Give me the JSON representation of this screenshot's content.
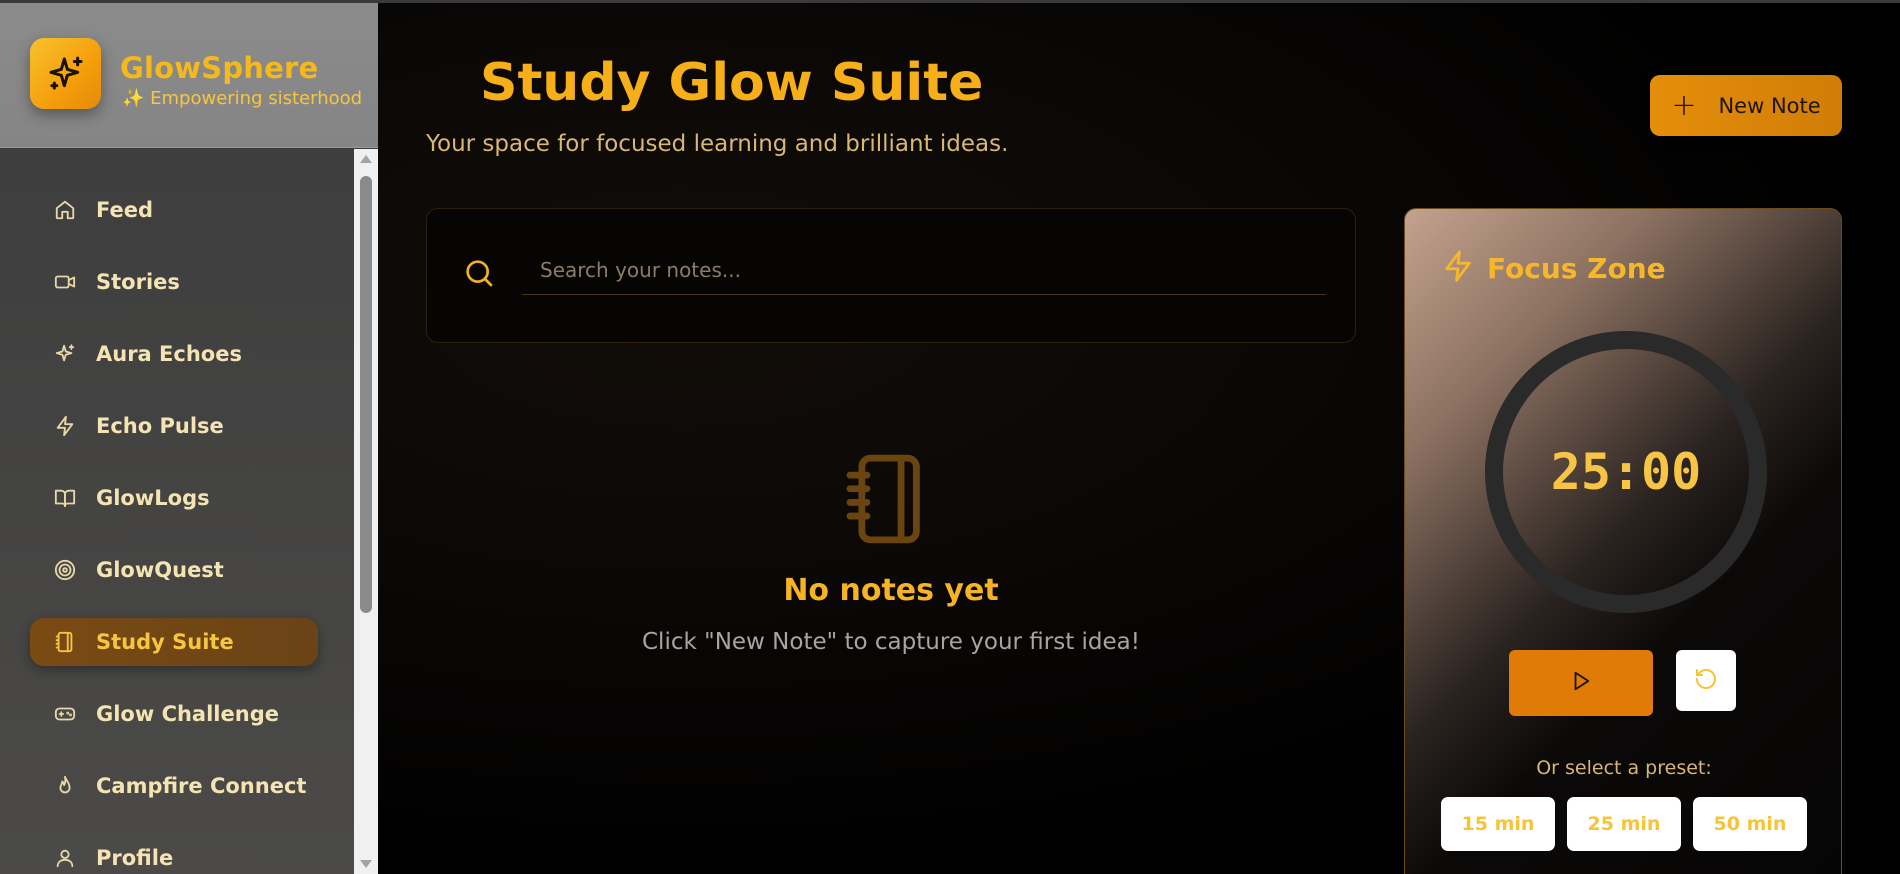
{
  "brand": {
    "name": "GlowSphere",
    "tagline": "✨ Empowering sisterhood",
    "logo_icon": "sparkles-icon"
  },
  "sidebar": {
    "items": [
      {
        "label": "Feed",
        "icon": "home-icon",
        "active": false
      },
      {
        "label": "Stories",
        "icon": "video-icon",
        "active": false
      },
      {
        "label": "Aura Echoes",
        "icon": "sparkles-icon",
        "active": false
      },
      {
        "label": "Echo Pulse",
        "icon": "zap-icon",
        "active": false
      },
      {
        "label": "GlowLogs",
        "icon": "book-open-icon",
        "active": false
      },
      {
        "label": "GlowQuest",
        "icon": "target-icon",
        "active": false
      },
      {
        "label": "Study Suite",
        "icon": "notebook-icon",
        "active": true
      },
      {
        "label": "Glow Challenge",
        "icon": "gamepad-icon",
        "active": false
      },
      {
        "label": "Campfire Connect",
        "icon": "flame-icon",
        "active": false
      },
      {
        "label": "Profile",
        "icon": "user-icon",
        "active": false
      }
    ]
  },
  "header": {
    "title": "Study Glow Suite",
    "subtitle": "Your space for focused learning and brilliant ideas.",
    "new_note_label": "New Note"
  },
  "search": {
    "placeholder": "Search your notes...",
    "value": ""
  },
  "empty_state": {
    "title": "No notes yet",
    "text": "Click \"New Note\" to capture your first idea!",
    "icon": "notebook-icon"
  },
  "focus": {
    "title": "Focus Zone",
    "icon": "zap-icon",
    "timer": "25:00",
    "preset_label": "Or select a preset:",
    "presets": [
      "15 min",
      "25 min",
      "50 min"
    ]
  },
  "colors": {
    "accent": "#f6ae19",
    "active_nav_bg": "#7a4a13",
    "button_orange": "#df7b06"
  }
}
